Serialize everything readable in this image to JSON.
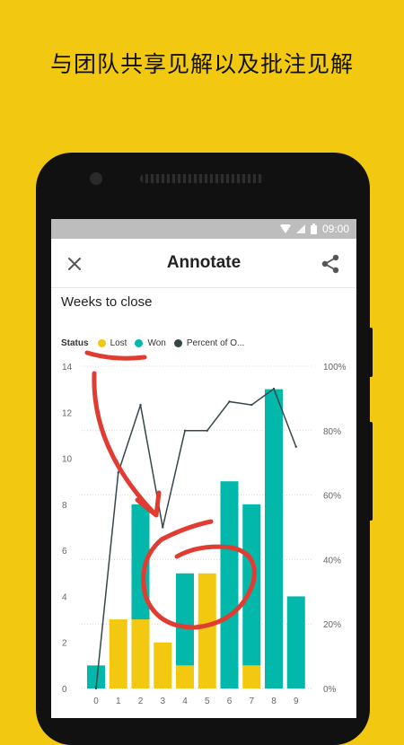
{
  "promo": {
    "headline": "与团队共享见解以及批注见解"
  },
  "statusbar": {
    "time": "09:00"
  },
  "appbar": {
    "title": "Annotate",
    "close_icon": "close-icon",
    "share_icon": "share-icon"
  },
  "colors": {
    "background": "#F2C811",
    "lost": "#F2C811",
    "won": "#01B8AA",
    "percent": "#374649",
    "annotation": "#E03C31"
  },
  "chart_data": {
    "type": "bar",
    "title": "Weeks to close",
    "legend_title": "Status",
    "categories": [
      "0",
      "1",
      "2",
      "3",
      "4",
      "5",
      "6",
      "7",
      "8",
      "9"
    ],
    "series": [
      {
        "name": "Lost",
        "type": "bar",
        "values": [
          0,
          3,
          3,
          2,
          1,
          5,
          0,
          1,
          0,
          0
        ]
      },
      {
        "name": "Won",
        "type": "bar",
        "values": [
          1,
          0,
          5,
          0,
          4,
          0,
          9,
          7,
          13,
          4
        ]
      },
      {
        "name": "Percent of O...",
        "type": "line",
        "axis": "right",
        "values": [
          0,
          67,
          88,
          50,
          80,
          80,
          89,
          88,
          93,
          75
        ]
      }
    ],
    "ylim": [
      0,
      14
    ],
    "yticks": [
      "0",
      "2",
      "4",
      "6",
      "8",
      "10",
      "12",
      "14"
    ],
    "y2lim": [
      0,
      100
    ],
    "y2ticks": [
      "0%",
      "20%",
      "40%",
      "60%",
      "80%",
      "100%"
    ],
    "grid": true,
    "legend_position": "top-left",
    "stacked": true
  }
}
